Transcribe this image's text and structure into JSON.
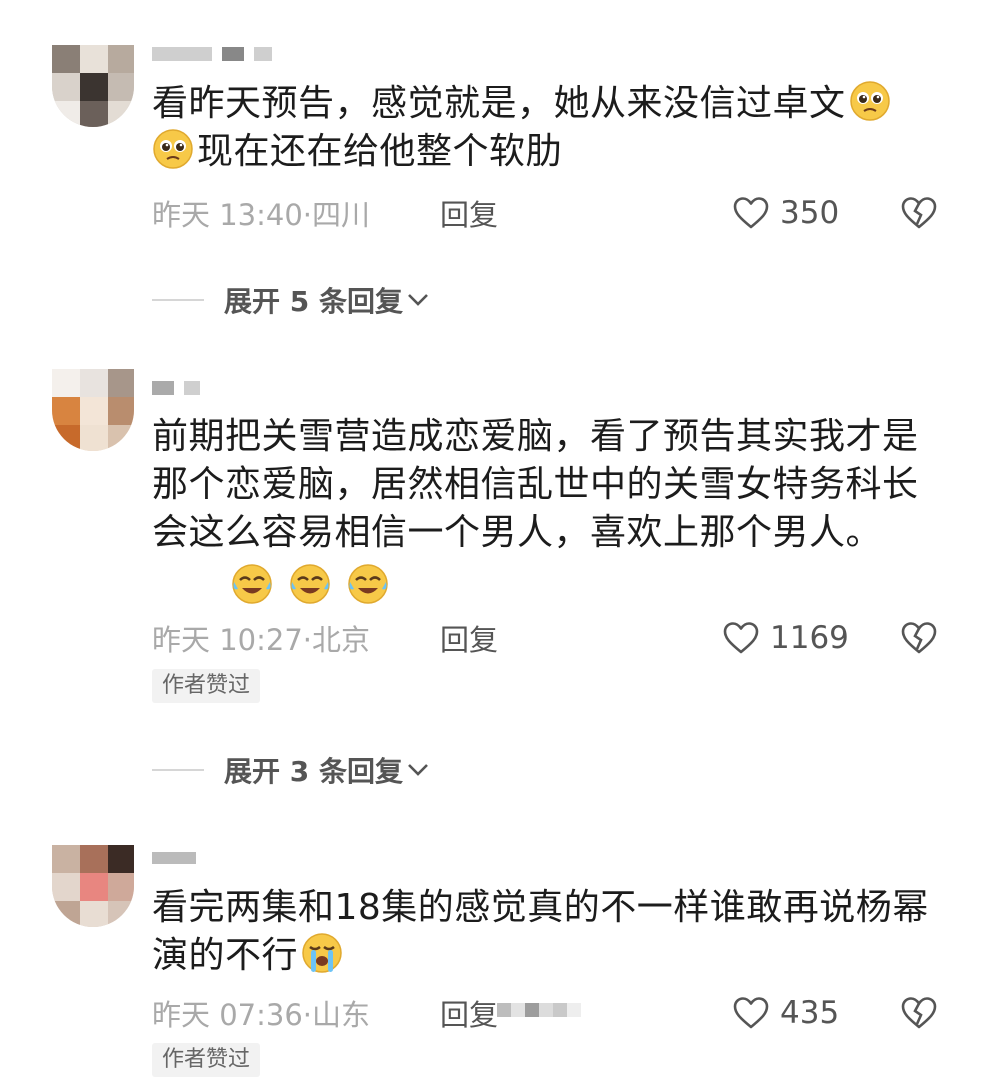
{
  "comments": [
    {
      "text_line1": "看昨天预告，感觉就是，她从来没信过卓文",
      "text_line2": "现在还在给他整个软肋",
      "time": "昨天 13:40",
      "location": "四川",
      "reply_label": "回复",
      "likes": "350",
      "expand_label": "展开 5 条回复",
      "emoji": "pleading-face"
    },
    {
      "text": "前期把关雪营造成恋爱脑，看了预告其实我才是那个恋爱脑，居然相信乱世中的关雪女特务科长会这么容易相信一个男人，喜欢上那个男人。",
      "time": "昨天 10:27",
      "location": "北京",
      "reply_label": "回复",
      "likes": "1169",
      "badge": "作者赞过",
      "expand_label": "展开 3 条回复",
      "emoji": "crying-laughing-face"
    },
    {
      "text": "看完两集和18集的感觉真的不一样谁敢再说杨幂演的不行",
      "time": "昨天 07:36",
      "location": "山东",
      "reply_label": "回复",
      "likes": "435",
      "badge": "作者赞过",
      "emoji": "sobbing-face"
    }
  ],
  "colors": {
    "text": "#1c1c1c",
    "meta": "#a9a9a9",
    "icon": "#555555",
    "badge_bg": "#f2f2f2",
    "emoji_yellow": "#f7c948"
  }
}
